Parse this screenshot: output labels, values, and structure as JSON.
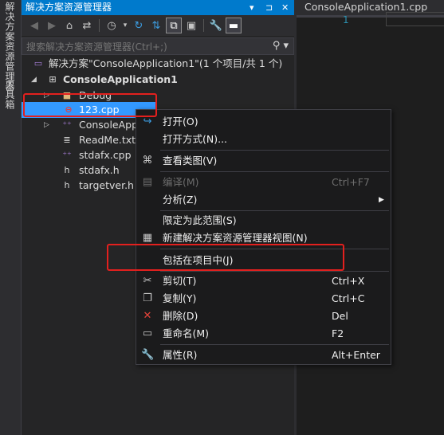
{
  "left_strip": {
    "tab1": "解决方案资源管理器",
    "tab2": "工具箱"
  },
  "solution_explorer": {
    "title": "解决方案资源管理器",
    "title_buttons": [
      "▾",
      "⊐",
      "✕"
    ],
    "search_placeholder": "搜索解决方案资源管理器(Ctrl+;)",
    "tree": [
      {
        "label": "解决方案\"ConsoleApplication1\"(1 个项目/共 1 个)",
        "icon": "solution-icon"
      },
      {
        "label": "ConsoleApplication1",
        "icon": "project-icon"
      },
      {
        "label": "Debug",
        "icon": "folder-icon"
      },
      {
        "label": "123.cpp",
        "icon": "excluded-cpp-icon"
      },
      {
        "label": "ConsoleApp",
        "icon": "cpp-file-icon"
      },
      {
        "label": "ReadMe.txt",
        "icon": "text-file-icon"
      },
      {
        "label": "stdafx.cpp",
        "icon": "cpp-file-icon"
      },
      {
        "label": "stdafx.h",
        "icon": "header-file-icon"
      },
      {
        "label": "targetver.h",
        "icon": "header-file-icon"
      }
    ]
  },
  "editor": {
    "tab_title": "ConsoleApplication1.cpp",
    "line_number": "1"
  },
  "context_menu": {
    "items": [
      {
        "label": "打开(O)",
        "shortcut": "",
        "icon": "open-icon",
        "enabled": true
      },
      {
        "label": "打开方式(N)...",
        "shortcut": "",
        "icon": "",
        "enabled": true
      },
      {
        "label": "查看类图(V)",
        "shortcut": "",
        "icon": "class-diagram-icon",
        "enabled": true
      },
      {
        "label": "编译(M)",
        "shortcut": "Ctrl+F7",
        "icon": "compile-icon",
        "enabled": false
      },
      {
        "label": "分析(Z)",
        "shortcut": "",
        "icon": "",
        "enabled": true,
        "submenu": true
      },
      {
        "label": "限定为此范围(S)",
        "shortcut": "",
        "icon": "",
        "enabled": true
      },
      {
        "label": "新建解决方案资源管理器视图(N)",
        "shortcut": "",
        "icon": "new-view-icon",
        "enabled": true
      },
      {
        "label": "包括在项目中(J)",
        "shortcut": "",
        "icon": "",
        "enabled": true
      },
      {
        "label": "剪切(T)",
        "shortcut": "Ctrl+X",
        "icon": "cut-icon",
        "enabled": true
      },
      {
        "label": "复制(Y)",
        "shortcut": "Ctrl+C",
        "icon": "copy-icon",
        "enabled": true
      },
      {
        "label": "删除(D)",
        "shortcut": "Del",
        "icon": "delete-icon",
        "enabled": true
      },
      {
        "label": "重命名(M)",
        "shortcut": "F2",
        "icon": "rename-icon",
        "enabled": true
      },
      {
        "label": "属性(R)",
        "shortcut": "Alt+Enter",
        "icon": "properties-icon",
        "enabled": true
      }
    ],
    "submenu_arrow": "▶"
  },
  "colors": {
    "accent": "#007acc",
    "selection": "#3399ff",
    "highlight_box": "#e3201e",
    "menu_bg": "#1b1b1c",
    "panel_bg": "#252526"
  }
}
